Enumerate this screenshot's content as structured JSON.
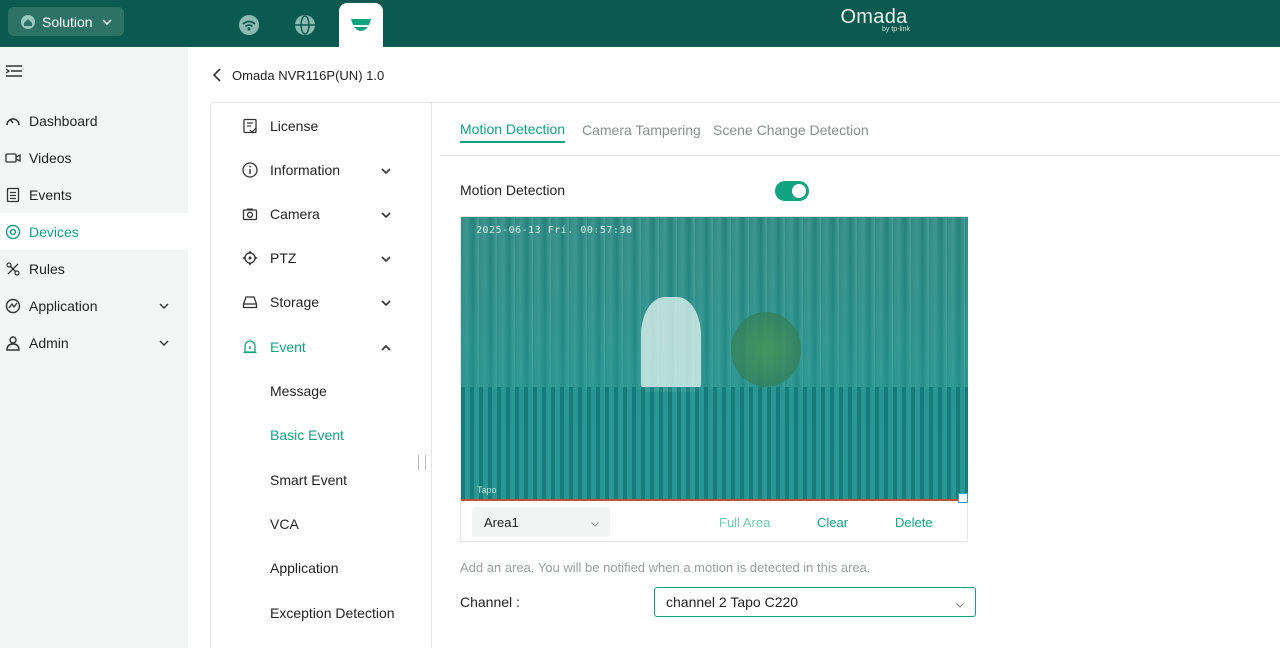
{
  "topbar": {
    "solution_label": "Solution",
    "brand_name": "Omada",
    "brand_sub": "by tp-link",
    "icons": [
      "wifi-network-icon",
      "globe-icon",
      "camera-surveillance-icon"
    ]
  },
  "leftnav": {
    "items": [
      {
        "label": "Dashboard",
        "icon": "dashboard-icon"
      },
      {
        "label": "Videos",
        "icon": "video-icon"
      },
      {
        "label": "Events",
        "icon": "events-icon"
      },
      {
        "label": "Devices",
        "icon": "devices-icon",
        "active": true
      },
      {
        "label": "Rules",
        "icon": "rules-icon"
      },
      {
        "label": "Application",
        "icon": "application-icon",
        "expandable": true
      },
      {
        "label": "Admin",
        "icon": "admin-icon",
        "expandable": true
      }
    ]
  },
  "header": {
    "device_title": "Omada NVR116P(UN) 1.0"
  },
  "subnav": {
    "items": [
      {
        "label": "License",
        "icon": "license-icon"
      },
      {
        "label": "Information",
        "icon": "info-icon",
        "expandable": true
      },
      {
        "label": "Camera",
        "icon": "camera-icon",
        "expandable": true
      },
      {
        "label": "PTZ",
        "icon": "ptz-icon",
        "expandable": true
      },
      {
        "label": "Storage",
        "icon": "storage-icon",
        "expandable": true
      },
      {
        "label": "Event",
        "icon": "event-icon",
        "expanded": true,
        "active": true
      }
    ],
    "event_children": [
      {
        "label": "Message"
      },
      {
        "label": "Basic Event",
        "active": true
      },
      {
        "label": "Smart Event"
      },
      {
        "label": "VCA"
      },
      {
        "label": "Application"
      },
      {
        "label": "Exception Detection"
      }
    ]
  },
  "tabs": [
    {
      "label": "Motion Detection",
      "active": true
    },
    {
      "label": "Camera Tampering"
    },
    {
      "label": "Scene Change Detection"
    }
  ],
  "motion": {
    "label": "Motion Detection",
    "enabled": true,
    "osd_text": "2025-06-13 Fri. 00:57:30",
    "watermark": "Tapo",
    "area_value": "Area1",
    "full_area_label": "Full Area",
    "clear_label": "Clear",
    "delete_label": "Delete",
    "hint": "Add an area. You will be notified when a motion is detected in this area.",
    "channel_label": "Channel :",
    "channel_value": "channel 2 Tapo C220"
  },
  "colors": {
    "topbar": "#0b5a4f",
    "accent": "#10a37f",
    "nav_bg": "#f4f5f5"
  }
}
